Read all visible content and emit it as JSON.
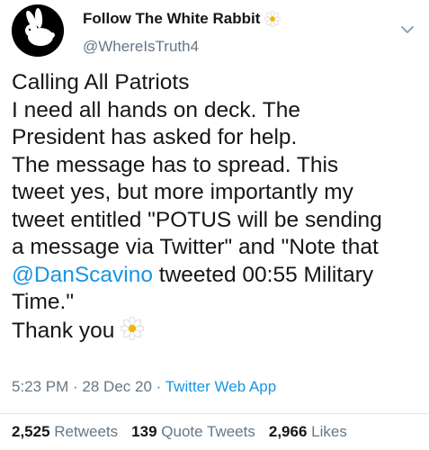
{
  "tweet": {
    "display_name": "Follow The White Rabbit",
    "handle": "@WhereIsTruth4",
    "lines": {
      "l1": "Calling All Patriots",
      "l2": "I need all hands on deck. The",
      "l3": "President has asked for help.",
      "l4": "The message has to spread. This",
      "l5": "tweet yes, but more importantly my",
      "l6": "tweet entitled \"POTUS will be sending",
      "l7": "a message via Twitter\" and \"Note that",
      "l8_mention": "@DanScavino",
      "l8_rest": " tweeted 00:55 Military",
      "l9": "Time.\"",
      "l10": "Thank you"
    },
    "time": "5:23 PM",
    "sep1": " · ",
    "date": "28 Dec 20",
    "sep2": " · ",
    "app": "Twitter Web App",
    "stats": {
      "retweets_count": "2,525",
      "retweets_label": "Retweets",
      "quotes_count": "139",
      "quotes_label": "Quote Tweets",
      "likes_count": "2,966",
      "likes_label": "Likes"
    }
  },
  "icons": {
    "avatar": "white-rabbit-icon",
    "name_flower": "daisy-emoji-icon",
    "caret": "chevron-down-icon",
    "thankyou_flower": "daisy-emoji-icon"
  },
  "colors": {
    "link": "#1b95e0",
    "secondary_text": "#657786",
    "primary_text": "#14171a"
  }
}
